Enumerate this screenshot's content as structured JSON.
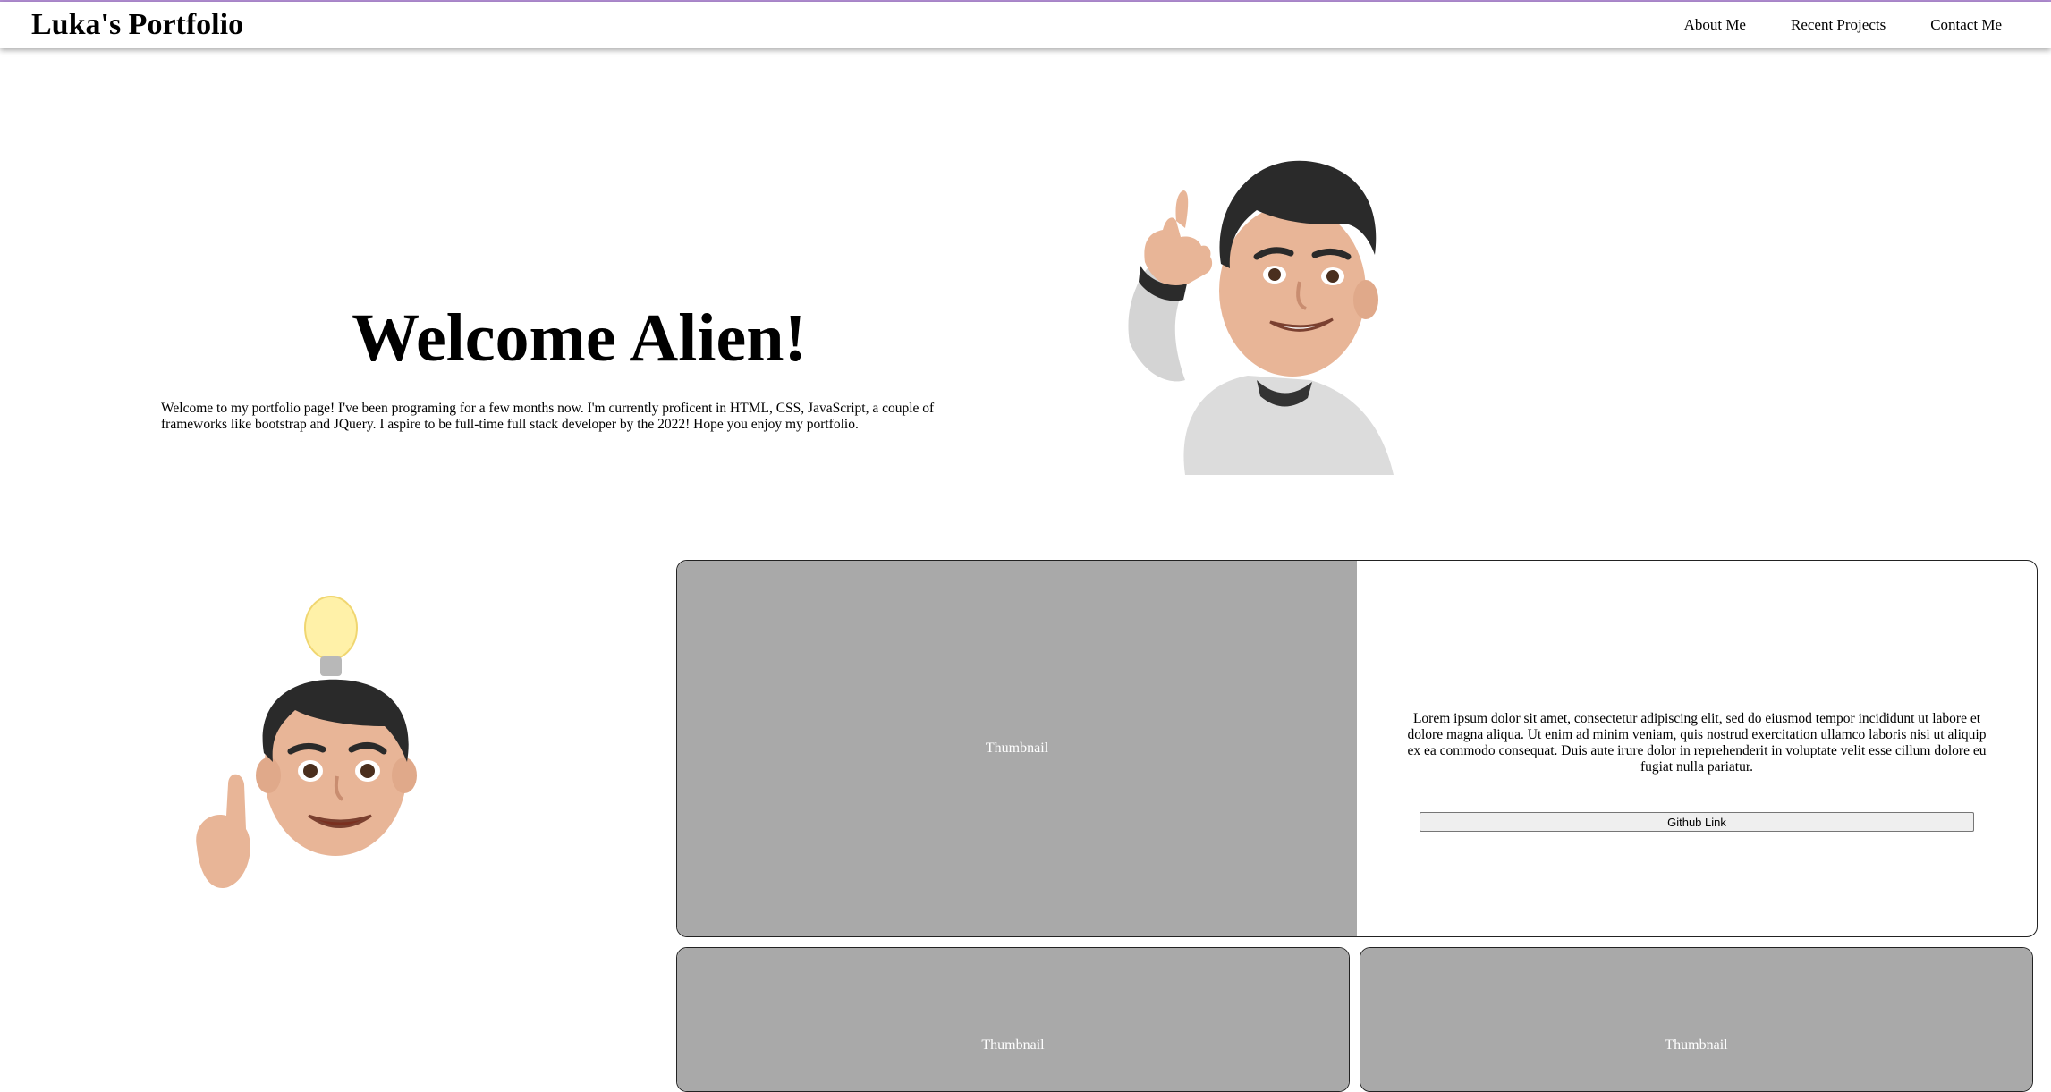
{
  "header": {
    "brand": "Luka's Portfolio",
    "nav": [
      {
        "label": "About Me"
      },
      {
        "label": "Recent Projects"
      },
      {
        "label": "Contact Me"
      }
    ]
  },
  "hero": {
    "title": "Welcome Alien!",
    "intro": "Welcome to my portfolio page! I've been programing for a few months now. I'm currently proficent in HTML, CSS, JavaScript, a couple of frameworks like bootstrap and JQuery. I aspire to be full-time full stack developer by the 2022! Hope you enjoy my portfolio."
  },
  "projects": {
    "featured": {
      "thumbnail": "Thumbnail",
      "description": "Lorem ipsum dolor sit amet, consectetur adipiscing elit, sed do eiusmod tempor incididunt ut labore et dolore magna aliqua. Ut enim ad minim veniam, quis nostrud exercitation ullamco laboris nisi ut aliquip ex ea commodo consequat. Duis aute irure dolor in reprehenderit in voluptate velit esse cillum dolore eu fugiat nulla pariatur.",
      "button": "Github Link"
    },
    "cards": [
      {
        "thumbnail": "Thumbnail"
      },
      {
        "thumbnail": "Thumbnail"
      }
    ]
  },
  "colors": {
    "accent_line": "#b48fd6",
    "thumbnail_bg": "#a9a9a9"
  }
}
